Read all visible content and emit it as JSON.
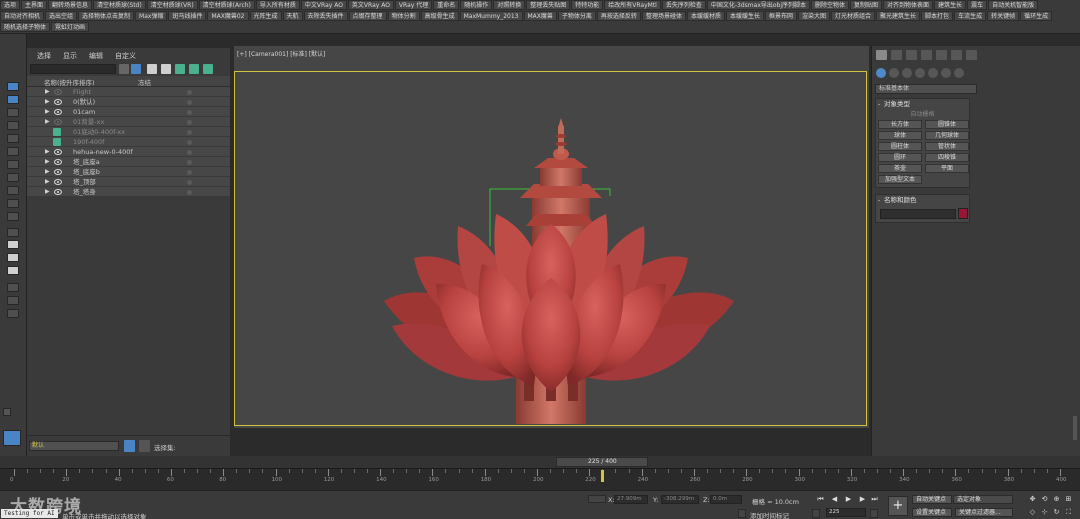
{
  "toolbar": {
    "row1": [
      "选项",
      "主界面",
      "翻转场景信息",
      "清空材质球(Std)",
      "清空材质球(VR)",
      "清空材质球(Arch)",
      "导入所有材质",
      "中文VRay AO",
      "英文VRay AO",
      "VRay 代理",
      "重命名",
      "随机操作",
      "对照转换",
      "整理丢失贴图",
      "特特功能",
      "给改所有VRayMtl",
      "丢失序列检查",
      "中国文化-3dsmax导出obj序列脚本",
      "删除空物体",
      "复制贴图",
      "对齐到物体表面",
      "建筑生长",
      "震车",
      "自动关机智能版"
    ],
    "row2": [
      "自动对齐相机",
      "选出空组",
      "选择物体点击复制",
      "Max弹缩",
      "斑马线插件",
      "MAX魔兽02",
      "光阵生成",
      "天航",
      "去除丢失插件",
      "点缀存整理",
      "物体分割",
      "高级骨生成",
      "MaxMummy_2013",
      "MAX魔兽",
      "子物体分离",
      "再按选择反转",
      "整理场景碰体",
      "本缓缓材质",
      "本缓缓生长",
      "框景布网",
      "渲染大图",
      "灯光材质组合",
      "聚光建筑生长",
      "脚本打包",
      "车流生成",
      "转关键帧",
      "循环生成"
    ],
    "row3": [
      "随机选择子物体",
      "霓虹灯动画"
    ]
  },
  "explorer": {
    "menu": [
      "选择",
      "显示",
      "编辑",
      "自定义"
    ],
    "col_name": "名称(按升序排序)",
    "col_freeze": "冻结",
    "rows": [
      {
        "name": "Flight",
        "dim": true,
        "expand": true,
        "eye": false
      },
      {
        "name": "0(默认)",
        "dim": false,
        "expand": true,
        "eye": true
      },
      {
        "name": "01cam",
        "dim": false,
        "expand": true,
        "eye": true
      },
      {
        "name": "01背景-xx",
        "dim": true,
        "expand": true,
        "eye": false
      },
      {
        "name": "01底动0-400f-xx",
        "dim": true,
        "expand": false,
        "eye": false
      },
      {
        "name": "190f-400f",
        "dim": true,
        "expand": false,
        "eye": false
      },
      {
        "name": "hehua-new-0-400f",
        "dim": false,
        "expand": true,
        "eye": true
      },
      {
        "name": "塔_底座a",
        "dim": false,
        "expand": true,
        "eye": true
      },
      {
        "name": "塔_底座b",
        "dim": false,
        "expand": true,
        "eye": true
      },
      {
        "name": "塔_顶部",
        "dim": false,
        "expand": true,
        "eye": true
      },
      {
        "name": "塔_塔身",
        "dim": false,
        "expand": true,
        "eye": true
      }
    ],
    "layer_value": "默认",
    "selection_set_label": "选择集:"
  },
  "viewport": {
    "label": "[+] [Camera001] [标准] [默认]"
  },
  "command_panel": {
    "dropdown": "标准基本体",
    "rollout_object_type": "对象类型",
    "autogrid": "自动栅格",
    "objects": [
      "长方体",
      "圆锥体",
      "球体",
      "几何球体",
      "圆柱体",
      "管状体",
      "圆环",
      "四棱锥",
      "茶壶",
      "平面",
      "加强型文本"
    ],
    "rollout_name_color": "名称和颜色",
    "color": "#9a1535"
  },
  "timeline": {
    "slider_label": "225 / 400",
    "current_frame": 225,
    "total_frames": 400,
    "ticks": [
      0,
      20,
      40,
      60,
      80,
      100,
      120,
      140,
      160,
      180,
      200,
      220,
      240,
      260,
      280,
      300,
      320,
      340,
      360,
      380,
      400
    ],
    "frame_counter": "1 /"
  },
  "status": {
    "watermark": "大数跨境",
    "badge": "Testing for AI",
    "prompt": "单击或单击并拖动以选择对象",
    "x_value": "27.909m",
    "y_value": "-308.299m",
    "z_value": "0.0m",
    "grid_label": "栅格 = 10.0cm",
    "add_time_tag": "添加时间标记",
    "autokey": "自动关键点",
    "selected_object": "选定对象",
    "set_key": "设置关键点",
    "key_filter": "关键点过滤器...",
    "frame_field": "225",
    "accent": "#d2c340"
  }
}
